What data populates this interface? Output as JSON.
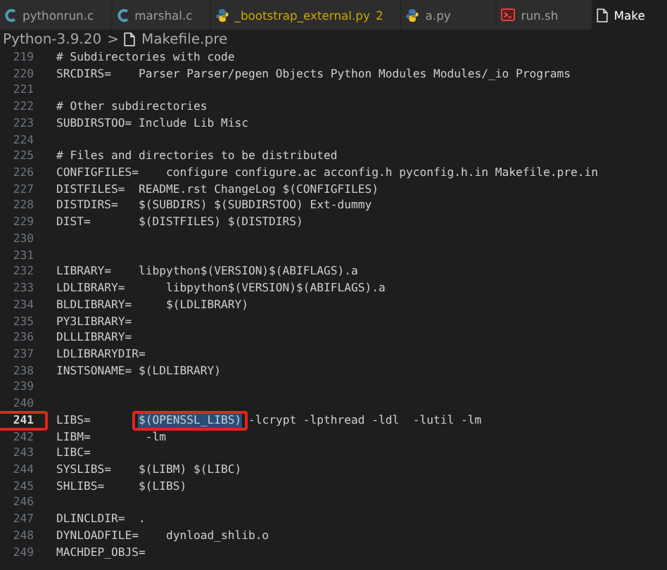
{
  "tabs": [
    {
      "kind": "c",
      "label": "pythonrun.c",
      "selected": false
    },
    {
      "kind": "c",
      "label": "marshal.c",
      "selected": false
    },
    {
      "kind": "python",
      "label": "_bootstrap_external.py",
      "problems": "2",
      "selected": false
    },
    {
      "kind": "python",
      "label": "a.py",
      "selected": false
    },
    {
      "kind": "shell",
      "label": "run.sh",
      "selected": false
    },
    {
      "kind": "file",
      "label": "Make",
      "selected": true
    }
  ],
  "breadcrumb": {
    "folder": "Python-3.9.20",
    "separator": ">",
    "file": "Makefile.pre"
  },
  "lines": [
    {
      "num": "219",
      "text": "# Subdirectories with code",
      "current": false
    },
    {
      "num": "220",
      "text": "SRCDIRS=    Parser Parser/pegen Objects Python Modules Modules/_io Programs",
      "current": false
    },
    {
      "num": "221",
      "current": false
    },
    {
      "num": "222",
      "text": "# Other subdirectories",
      "current": false
    },
    {
      "num": "223",
      "text": "SUBDIRSTOO= Include Lib Misc",
      "current": false
    },
    {
      "num": "224",
      "current": false
    },
    {
      "num": "225",
      "text": "# Files and directories to be distributed",
      "current": false
    },
    {
      "num": "226",
      "text": "CONFIGFILES=    configure configure.ac acconfig.h pyconfig.h.in Makefile.pre.in",
      "current": false
    },
    {
      "num": "227",
      "text": "DISTFILES=  README.rst ChangeLog $(CONFIGFILES)",
      "current": false
    },
    {
      "num": "228",
      "text": "DISTDIRS=   $(SUBDIRS) $(SUBDIRSTOO) Ext-dummy",
      "current": false
    },
    {
      "num": "229",
      "text": "DIST=       $(DISTFILES) $(DISTDIRS)",
      "current": false
    },
    {
      "num": "230",
      "current": false
    },
    {
      "num": "231",
      "current": false
    },
    {
      "num": "232",
      "text": "LIBRARY=    libpython$(VERSION)$(ABIFLAGS).a",
      "current": false
    },
    {
      "num": "233",
      "text": "LDLIBRARY=      libpython$(VERSION)$(ABIFLAGS).a",
      "current": false
    },
    {
      "num": "234",
      "text": "BLDLIBRARY=     $(LDLIBRARY)",
      "current": false
    },
    {
      "num": "235",
      "text": "PY3LIBRARY=",
      "current": false
    },
    {
      "num": "236",
      "text": "DLLLIBRARY=",
      "current": false
    },
    {
      "num": "237",
      "text": "LDLIBRARYDIR=",
      "current": false
    },
    {
      "num": "238",
      "text": "INSTSONAME= $(LDLIBRARY)",
      "current": false
    },
    {
      "num": "239",
      "current": false
    },
    {
      "num": "240",
      "current": false
    },
    {
      "num": "241",
      "current": true,
      "marked": true,
      "parts": [
        {
          "text": "LIBS=       ",
          "selected": false,
          "marked": false
        },
        {
          "text": "$(OPENSSL_LIBS)",
          "selected": true,
          "marked": true
        },
        {
          "text": " -lcrypt -lpthread -ldl  -lutil -lm",
          "selected": false,
          "marked": false
        }
      ]
    },
    {
      "num": "242",
      "text": "LIBM=        -lm",
      "current": false
    },
    {
      "num": "243",
      "text": "LIBC=",
      "current": false
    },
    {
      "num": "244",
      "text": "SYSLIBS=    $(LIBM) $(LIBC)",
      "current": false
    },
    {
      "num": "245",
      "text": "SHLIBS=     $(LIBS)",
      "current": false
    },
    {
      "num": "246",
      "current": false
    },
    {
      "num": "247",
      "text": "DLINCLDIR=  .",
      "current": false
    },
    {
      "num": "248",
      "text": "DYNLOADFILE=    dynload_shlib.o",
      "current": false
    },
    {
      "num": "249",
      "text": "MACHDEP_OBJS=",
      "current": false
    }
  ]
}
